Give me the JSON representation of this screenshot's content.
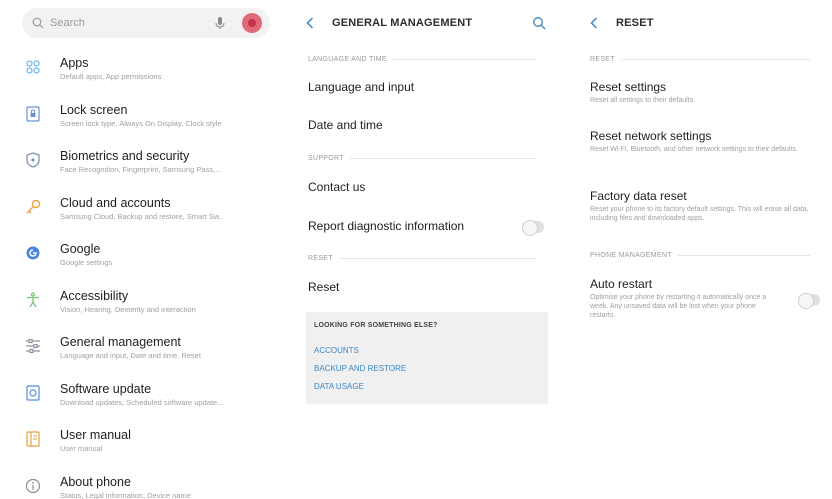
{
  "settings": {
    "search_placeholder": "Search",
    "items": [
      {
        "title": "Apps",
        "subtitle": "Default apps, App permissions",
        "icon": "apps-icon",
        "color": "#6fb6e8"
      },
      {
        "title": "Lock screen",
        "subtitle": "Screen lock type, Always On Display, Clock style",
        "icon": "lock-screen-icon",
        "color": "#6c8fd6"
      },
      {
        "title": "Biometrics and security",
        "subtitle": "Face Recognition, Fingerprint, Samsung Pass,...",
        "icon": "shield-icon",
        "color": "#7a8ca8"
      },
      {
        "title": "Cloud and accounts",
        "subtitle": "Samsung Cloud, Backup and restore, Smart Sw...",
        "icon": "key-icon",
        "color": "#f0a048"
      },
      {
        "title": "Google",
        "subtitle": "Google settings",
        "icon": "google-icon",
        "color": "#4a86e0"
      },
      {
        "title": "Accessibility",
        "subtitle": "Vision, Hearing, Dexterity and interaction",
        "icon": "accessibility-icon",
        "color": "#7cc07a"
      },
      {
        "title": "General management",
        "subtitle": "Language and input, Date and time, Reset",
        "icon": "sliders-icon",
        "color": "#8a8f9a"
      },
      {
        "title": "Software update",
        "subtitle": "Download updates, Scheduled software update...",
        "icon": "software-update-icon",
        "color": "#4d8fd9"
      },
      {
        "title": "User manual",
        "subtitle": "User manual",
        "icon": "user-manual-icon",
        "color": "#e8a040"
      },
      {
        "title": "About phone",
        "subtitle": "Status, Legal information, Device name",
        "icon": "info-icon",
        "color": "#8e8e8e"
      }
    ]
  },
  "general": {
    "title": "GENERAL MANAGEMENT",
    "section_language": "LANGUAGE AND TIME",
    "language_input": "Language and input",
    "date_time": "Date and time",
    "section_support": "SUPPORT",
    "contact_us": "Contact us",
    "report_diagnostic": "Report diagnostic information",
    "section_reset": "RESET",
    "reset": "Reset",
    "look_title": "LOOKING FOR SOMETHING ELSE?",
    "links": [
      "ACCOUNTS",
      "BACKUP AND RESTORE",
      "DATA USAGE"
    ]
  },
  "reset": {
    "title": "RESET",
    "section_reset": "RESET",
    "reset_settings": {
      "title": "Reset settings",
      "subtitle": "Reset all settings to their defaults."
    },
    "reset_network": {
      "title": "Reset network settings",
      "subtitle": "Reset Wi-Fi, Bluetooth, and other network settings to their defaults."
    },
    "factory_reset": {
      "title": "Factory data reset",
      "subtitle": "Reset your phone to its factory default settings. This will erase all data, including files and downloaded apps."
    },
    "section_phone": "PHONE MANAGEMENT",
    "auto_restart": {
      "title": "Auto restart",
      "subtitle": "Optimise your phone by restarting it automatically once a week. Any unsaved data will be lost when your phone restarts."
    }
  },
  "colors": {
    "accent": "#3a86c4",
    "toggle_off": "#e0e0e0"
  }
}
